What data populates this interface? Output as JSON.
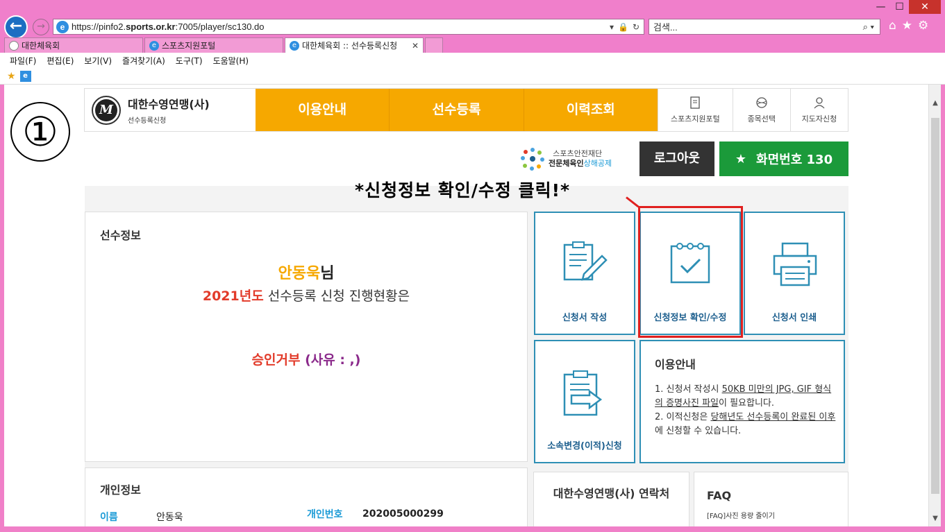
{
  "browser": {
    "url": "https://pinfo2.sports.or.kr:7005/player/sc130.do",
    "url_prefix": "https://pinfo2.",
    "url_domain": "sports.or.kr",
    "url_suffix": ":7005/player/sc130.do",
    "search_placeholder": "검색...",
    "tabs": [
      {
        "label": "대한체육회"
      },
      {
        "label": "스포츠지원포털"
      },
      {
        "label": "대한체육회 :: 선수등록신청"
      }
    ],
    "menu": [
      "파일(F)",
      "편집(E)",
      "보기(V)",
      "즐겨찾기(A)",
      "도구(T)",
      "도움말(H)"
    ]
  },
  "annotation": {
    "step_number": "①",
    "instruction": "*신청정보 확인/수정 클릭!*"
  },
  "site": {
    "org_name": "대한수영연맹(사)",
    "org_sub": "선수등록신청",
    "nav": [
      "이용안내",
      "선수등록",
      "이력조회"
    ],
    "util": [
      "스포츠지원포털",
      "종목선택",
      "지도자신청"
    ],
    "safety_line1": "스포츠안전재단",
    "safety_line2a": "전문체육인",
    "safety_line2b": "상해공제",
    "logout_label": "로그아웃",
    "screen_label": "화면번호 130"
  },
  "player": {
    "section_title": "선수정보",
    "name": "안동욱",
    "name_suffix": "님",
    "year": "2021년도",
    "status_text": "선수등록 신청 진행현황은",
    "result": "승인거부",
    "reason": "(사유 : ,)"
  },
  "cards": {
    "write": "신청서 작성",
    "confirm": "신청정보 확인/수정",
    "print": "신청서 인쇄",
    "transfer": "소속변경(이적)신청"
  },
  "guide": {
    "title": "이용안내",
    "item1_a": "1. 신청서 작성시 ",
    "item1_b": "50KB 미만의 JPG, GIF 형식의 증명사진 파일",
    "item1_c": "이 필요합니다.",
    "item2_a": "2. 이적신청은 ",
    "item2_b": "당해년도 선수등록이 완료된 이후",
    "item2_c": "에 신청할 수 있습니다."
  },
  "personal": {
    "title": "개인정보",
    "name_label": "이름",
    "name_value": "안동욱",
    "id_label": "개인번호",
    "id_value": "202005000299"
  },
  "contact": {
    "title": "대한수영연맹(사) 연락처"
  },
  "faq": {
    "title": "FAQ",
    "item": "[FAQ]사진 용량 줄이기"
  },
  "colors": {
    "nav_orange": "#f6a800",
    "card_border": "#2e8fb5",
    "screen_green": "#1b9a3a",
    "alert_red": "#e23b2a"
  }
}
